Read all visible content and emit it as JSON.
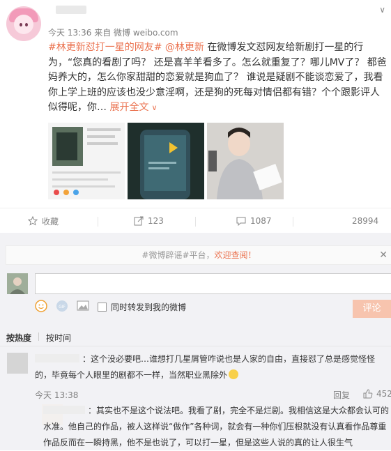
{
  "post": {
    "meta": "今天 13:36 来自 微博 weibo.com",
    "topic": "#林更新怼打一星的网友#",
    "mention": "@林更新",
    "text": " 在微博发文怼网友给新剧打一星的行为，“您真的看剧了吗？ 还是喜羊羊看多了。怎么就重复了？哪儿MV了？ 都爸妈养大的，怎么你家甜甜的恋爱就是狗血了？ 谁说是疑剧不能谈恋爱了，我看你上学上班的应该也没少意淫啊，还是狗的死每对情侣都有错？个个跟影评人似得呢，你…",
    "expand": " 展开全文"
  },
  "actions": {
    "favorite": "收藏",
    "forward": "123",
    "comment": "1087",
    "like": "28994"
  },
  "comments_panel": {
    "notice_main": "#微博辟谣#平台，",
    "notice_tail": "欢迎查阅！",
    "forward_option": "同时转发到我的微博",
    "submit": "评论",
    "sort_hot": "按热度",
    "sort_time": "按时间"
  },
  "comments": [
    {
      "text": "：这个没必要吧…谁想打几星屑管咋说也是人家的自由，直接怼了总是感觉怪怪的，毕竟每个人眼里的剧都不一样，当然职业黑除外",
      "time": "今天 13:38",
      "reply": "回复",
      "likes": "452"
    },
    {
      "text": "：其实也不是这个说法吧。我看了剧，完全不是烂剧。我相信这是大众都会认可的水准。他自己的作品，被人这样说“做作”各种词，就会有一种你们压根就没有认真看作品尊重作品反而在一瞬持黑，他不是也说了，可以打一星，但是这些人说的真的让人很生气"
    }
  ],
  "colors": {
    "accent": "#eb7350",
    "button": "#f7c4ae",
    "panel_bg": "#f2f2f5"
  }
}
